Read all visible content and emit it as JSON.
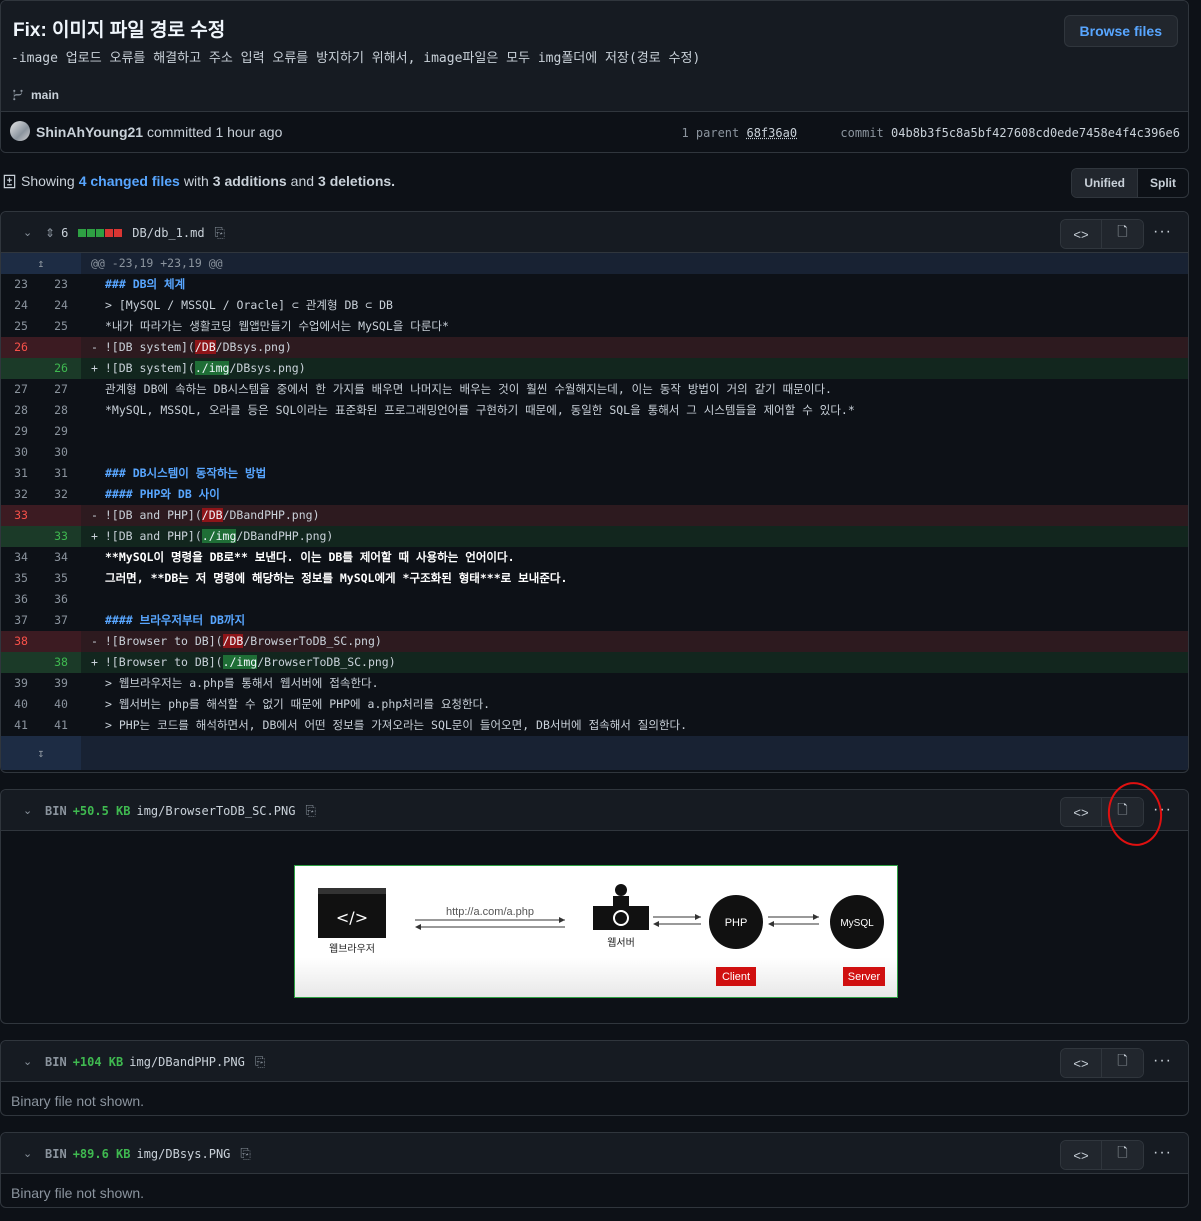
{
  "commit": {
    "title": "Fix: 이미지 파일 경로 수정",
    "description": "-image 업로드 오류를 해결하고 주소 입력 오류를 방지하기 위해서, image파일은 모두 img폴더에 저장(경로 수정)",
    "browse_label": "Browse files",
    "branch": "main",
    "author": "ShinAhYoung21",
    "committed_text": "committed",
    "time": "1 hour ago",
    "parent_label": "1 parent",
    "parent_sha": "68f36a0",
    "commit_label": "commit",
    "commit_sha": "04b8b3f5c8a5bf427608cd0ede7458e4f4c396e6"
  },
  "summary": {
    "showing": "Showing",
    "changed": "4 changed files",
    "with": "with",
    "additions": "3 additions",
    "and": "and",
    "deletions": "3 deletions."
  },
  "view_toggle": {
    "unified": "Unified",
    "split": "Split"
  },
  "files": [
    {
      "count": "6",
      "path": "DB/db_1.md",
      "hunk": "@@ -23,19 +23,19 @@",
      "lines": [
        {
          "type": "ctx",
          "old": "23",
          "new": "23",
          "text": "### DB의 체계"
        },
        {
          "type": "ctx",
          "old": "24",
          "new": "24",
          "text": "> [MySQL / MSSQL / Oracle] ⊂ 관계형 DB ⊂ DB"
        },
        {
          "type": "ctx",
          "old": "25",
          "new": "25",
          "text": "*내가 따라가는 생활코딩 웹앱만들기 수업에서는 MySQL을 다룬다*"
        },
        {
          "type": "del",
          "old": "26",
          "new": "",
          "pre": "- ![DB system](",
          "hl": "/DB",
          "post": "/DBsys.png)"
        },
        {
          "type": "add",
          "old": "",
          "new": "26",
          "pre": "+ ![DB system](",
          "hl": "./img",
          "post": "/DBsys.png)"
        },
        {
          "type": "ctx",
          "old": "27",
          "new": "27",
          "text": "관계형 DB에 속하는 DB시스템을 중에서 한 가지를 배우면 나머지는 배우는 것이 훨씬 수월해지는데, 이는 동작 방법이 거의 같기 때문이다."
        },
        {
          "type": "ctx",
          "old": "28",
          "new": "28",
          "text": "*MySQL, MSSQL, 오라클 등은 SQL이라는 표준화된 프로그래밍언어를 구현하기 때문에, 동일한 SQL을 통해서 그 시스템들을 제어할 수 있다.*"
        },
        {
          "type": "ctx",
          "old": "29",
          "new": "29",
          "text": ""
        },
        {
          "type": "ctx",
          "old": "30",
          "new": "30",
          "text": ""
        },
        {
          "type": "ctx",
          "old": "31",
          "new": "31",
          "text": "### DB시스템이 동작하는 방법"
        },
        {
          "type": "ctx",
          "old": "32",
          "new": "32",
          "text": "#### PHP와 DB 사이"
        },
        {
          "type": "del",
          "old": "33",
          "new": "",
          "pre": "- ![DB and PHP](",
          "hl": "/DB",
          "post": "/DBandPHP.png)"
        },
        {
          "type": "add",
          "old": "",
          "new": "33",
          "pre": "+ ![DB and PHP](",
          "hl": "./img",
          "post": "/DBandPHP.png)"
        },
        {
          "type": "ctx",
          "old": "34",
          "new": "34",
          "text": "**MySQL이 명령을 DB로** 보낸다. 이는 DB를 제어할 때 사용하는 언어이다."
        },
        {
          "type": "ctx",
          "old": "35",
          "new": "35",
          "text": "그러면, **DB는 저 명령에 해당하는 정보를 MySQL에게 *구조화된 형태***로 보내준다."
        },
        {
          "type": "ctx",
          "old": "36",
          "new": "36",
          "text": ""
        },
        {
          "type": "ctx",
          "old": "37",
          "new": "37",
          "text": "#### 브라우저부터 DB까지"
        },
        {
          "type": "del",
          "old": "38",
          "new": "",
          "pre": "- ![Browser to DB](",
          "hl": "/DB",
          "post": "/BrowserToDB_SC.png)"
        },
        {
          "type": "add",
          "old": "",
          "new": "38",
          "pre": "+ ![Browser to DB](",
          "hl": "./img",
          "post": "/BrowserToDB_SC.png)"
        },
        {
          "type": "ctx",
          "old": "39",
          "new": "39",
          "text": "> 웹브라우저는 a.php를 통해서 웹서버에 접속한다."
        },
        {
          "type": "ctx",
          "old": "40",
          "new": "40",
          "text": "> 웹서버는 php를 해석할 수 없기 때문에 PHP에 a.php처리를 요청한다."
        },
        {
          "type": "ctx",
          "old": "41",
          "new": "41",
          "text": "> PHP는 코드를 해석하면서, DB에서 어떤 정보를 가져오라는 SQL문이 들어오면, DB서버에 접속해서 질의한다."
        }
      ]
    },
    {
      "bin": "BIN",
      "size": "+50.5 KB",
      "path": "img/BrowserToDB_SC.PNG"
    },
    {
      "bin": "BIN",
      "size": "+104 KB",
      "path": "img/DBandPHP.PNG",
      "message": "Binary file not shown."
    },
    {
      "bin": "BIN",
      "size": "+89.6 KB",
      "path": "img/DBsys.PNG",
      "message": "Binary file not shown."
    }
  ],
  "diagram": {
    "url": "http://a.com/a.php",
    "browser_label": "웹브라우저",
    "webserver_label": "웹서버",
    "php_label": "PHP",
    "mysql_label": "MySQL",
    "client_label": "Client",
    "server_label": "Server",
    "code_glyph": "</>"
  }
}
